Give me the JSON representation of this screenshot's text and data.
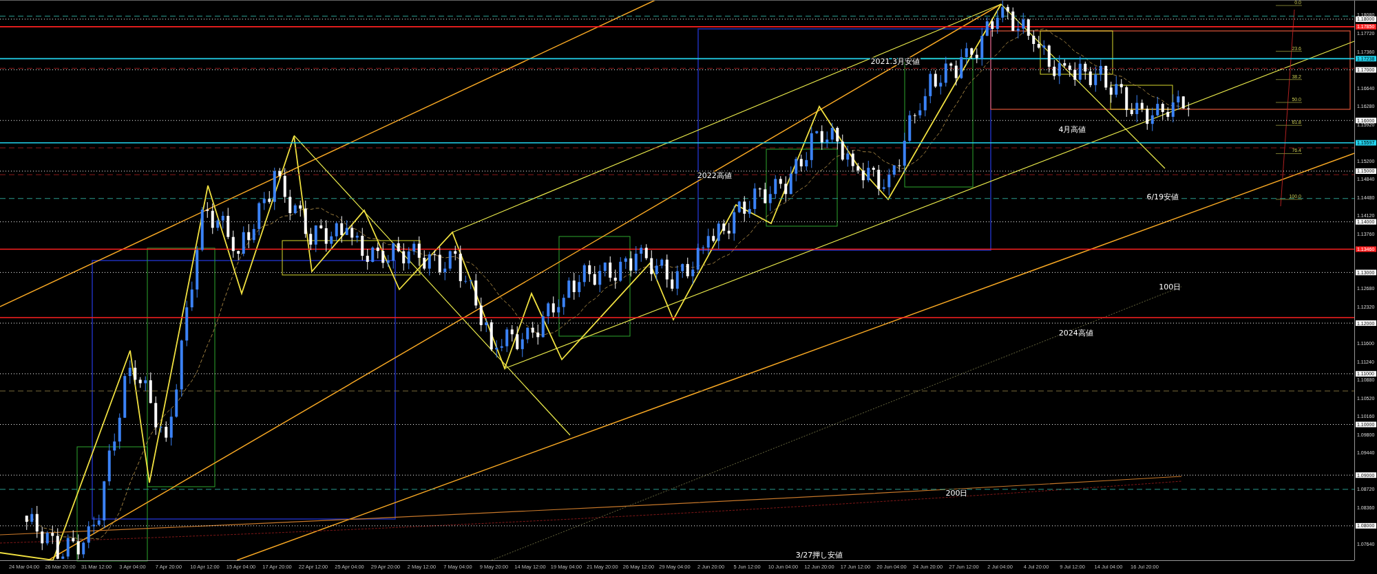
{
  "time_axis": {
    "labels": [
      "24 Mar 04:00",
      "26 Mar 20:00",
      "31 Mar 12:00",
      "3 Apr 04:00",
      "7 Apr 20:00",
      "10 Apr 12:00",
      "15 Apr 04:00",
      "17 Apr 20:00",
      "22 Apr 12:00",
      "25 Apr 04:00",
      "29 Apr 20:00",
      "2 May 12:00",
      "7 May 04:00",
      "9 May 20:00",
      "14 May 12:00",
      "19 May 04:00",
      "21 May 20:00",
      "26 May 12:00",
      "29 May 04:00",
      "2 Jun 20:00",
      "5 Jun 12:00",
      "10 Jun 04:00",
      "12 Jun 20:00",
      "17 Jun 12:00",
      "20 Jun 04:00",
      "24 Jun 20:00",
      "27 Jun 12:00",
      "2 Jul 04:00",
      "4 Jul 20:00",
      "9 Jul 12:00",
      "14 Jul 04:00",
      "16 Jul 20:00"
    ]
  },
  "price_axis": {
    "labels": [
      "1.18080",
      "1.17720",
      "1.17360",
      "1.16640",
      "1.16280",
      "1.15920",
      "1.15200",
      "1.14840",
      "1.14480",
      "1.14120",
      "1.13760",
      "1.12680",
      "1.12320",
      "1.11600",
      "1.11240",
      "1.10880",
      "1.10520",
      "1.10160",
      "1.09800",
      "1.09440",
      "1.08720",
      "1.08360",
      "1.07640"
    ]
  },
  "price_levels": [
    {
      "label": "1.18000",
      "color": "#ffffff"
    },
    {
      "label": "1.17850",
      "color": "#ff2020"
    },
    {
      "label": "1.17238",
      "color": "#22d3ee"
    },
    {
      "label": "1.17000",
      "color": "#ffffff"
    },
    {
      "label": "1.16000",
      "color": "#ffffff"
    },
    {
      "label": "1.15597",
      "color": "#22d3ee"
    },
    {
      "label": "1.15000",
      "color": "#ffffff"
    },
    {
      "label": "1.14000",
      "color": "#ffffff"
    },
    {
      "label": "1.13460",
      "color": "#ff2020"
    },
    {
      "label": "1.13000",
      "color": "#ffffff"
    },
    {
      "label": "1.12000",
      "color": "#ffffff"
    },
    {
      "label": "1.11000",
      "color": "#ffffff"
    },
    {
      "label": "1.10000",
      "color": "#ffffff"
    },
    {
      "label": "1.09000",
      "color": "#ffffff"
    },
    {
      "label": "1.08000",
      "color": "#ffffff"
    }
  ],
  "notes": [
    "2021.3月安値",
    "4月高値",
    "2022高値",
    "6/19安値",
    "100日",
    "2024高値",
    "200日",
    "3/27押し安値"
  ],
  "fibonacci_levels": [
    "0.0",
    "23.6",
    "38.2",
    "50.0",
    "61.8",
    "76.4",
    "100.0"
  ]
}
